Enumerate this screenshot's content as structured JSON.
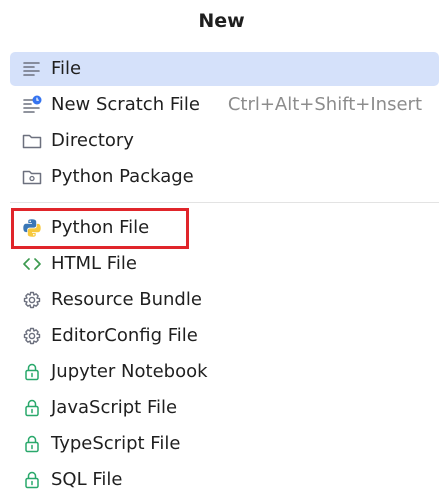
{
  "menu": {
    "title": "New",
    "items": [
      {
        "label": "File",
        "icon": "file-lines-icon"
      },
      {
        "label": "New Scratch File",
        "shortcut": "Ctrl+Alt+Shift+Insert",
        "icon": "scratch-file-icon"
      },
      {
        "label": "Directory",
        "icon": "folder-icon"
      },
      {
        "label": "Python Package",
        "icon": "package-folder-icon"
      },
      {
        "label": "Python File",
        "icon": "python-icon"
      },
      {
        "label": "HTML File",
        "icon": "html-code-icon"
      },
      {
        "label": "Resource Bundle",
        "icon": "gear-icon"
      },
      {
        "label": "EditorConfig File",
        "icon": "gear-icon"
      },
      {
        "label": "Jupyter Notebook",
        "icon": "lock-icon"
      },
      {
        "label": "JavaScript File",
        "icon": "lock-icon"
      },
      {
        "label": "TypeScript File",
        "icon": "lock-icon"
      },
      {
        "label": "SQL File",
        "icon": "lock-icon"
      }
    ]
  },
  "colors": {
    "selected_bg": "#d5e1fa",
    "highlight_border": "#e0252a",
    "lock_green": "#29a86b",
    "html_green": "#3d9a50",
    "icon_gray": "#6c707e"
  }
}
